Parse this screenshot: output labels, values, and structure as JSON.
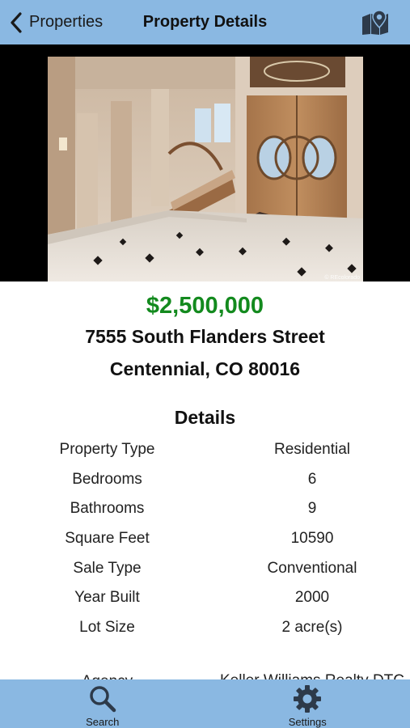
{
  "navbar": {
    "back_label": "Properties",
    "title": "Property Details",
    "map_icon": "map-icon"
  },
  "photo": {
    "alt": "Entry foyer with curved staircase and double wooden doors",
    "watermark": "© REcolorado"
  },
  "listing": {
    "price": "$2,500,000",
    "address_line1": "7555 South Flanders Street",
    "address_line2": "Centennial, CO 80016"
  },
  "details": {
    "title": "Details",
    "rows": [
      {
        "key": "Property Type",
        "value": "Residential"
      },
      {
        "key": "Bedrooms",
        "value": "6"
      },
      {
        "key": "Bathrooms",
        "value": "9"
      },
      {
        "key": "Square Feet",
        "value": "10590"
      },
      {
        "key": "Sale Type",
        "value": "Conventional"
      },
      {
        "key": "Year Built",
        "value": "2000"
      },
      {
        "key": "Lot Size",
        "value": "2 acre(s)"
      },
      {
        "key": "Agency",
        "value": "Keller Williams Realty DTC"
      }
    ]
  },
  "tabbar": {
    "tabs": [
      {
        "label": "Search",
        "icon": "search-icon"
      },
      {
        "label": "Settings",
        "icon": "gear-icon"
      }
    ]
  },
  "colors": {
    "bar": "#8ab8e2",
    "price": "#138a1e"
  }
}
